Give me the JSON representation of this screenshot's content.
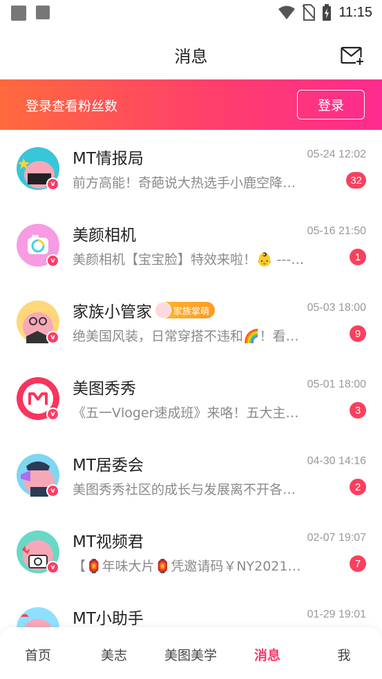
{
  "status_bar": {
    "time": "11:15"
  },
  "header": {
    "title": "消息"
  },
  "banner": {
    "text": "登录查看粉丝数",
    "login_label": "登录"
  },
  "messages": [
    {
      "name": "MT情报局",
      "time": "05-24 12:02",
      "preview": "前方高能！奇葩说大热选手小鹿空降…",
      "count": "32",
      "tag": ""
    },
    {
      "name": "美颜相机",
      "time": "05-16 21:50",
      "preview": "美颜相机【宝宝脸】特效来啦！👶 ---…",
      "count": "1",
      "tag": ""
    },
    {
      "name": "家族小管家",
      "time": "05-03 18:00",
      "preview": "绝美国风装，日常穿搭不违和🌈！看…",
      "count": "9",
      "tag": "家族掌萌"
    },
    {
      "name": "美图秀秀",
      "time": "05-01 18:00",
      "preview": "《五一Vloger速成班》来咯！五大主…",
      "count": "3",
      "tag": ""
    },
    {
      "name": "MT居委会",
      "time": "04-30 14:16",
      "preview": "美图秀秀社区的成长与发展离不开各…",
      "count": "2",
      "tag": ""
    },
    {
      "name": "MT视频君",
      "time": "02-07 19:07",
      "preview": "【🏮年味大片🏮凭邀请码￥NY2021…",
      "count": "7",
      "tag": ""
    },
    {
      "name": "MT小助手",
      "time": "01-29 19:01",
      "preview": "",
      "count": "",
      "tag": ""
    }
  ],
  "tabs": [
    {
      "label": "首页"
    },
    {
      "label": "美志"
    },
    {
      "label": "美图美学"
    },
    {
      "label": "消息"
    },
    {
      "label": "我"
    }
  ],
  "colors": {
    "accent": "#f73b6a",
    "banner_start": "#ff6a3d",
    "banner_end": "#fd2b8f",
    "badge": "#f9405e"
  }
}
